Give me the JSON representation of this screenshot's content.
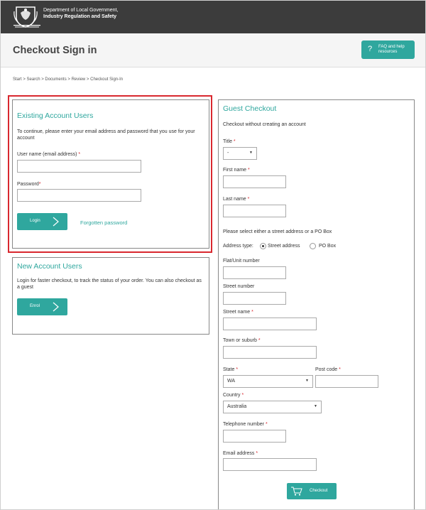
{
  "header": {
    "dept_line1": "Department of Local Government,",
    "dept_line2": "Industry Regulation and Safety",
    "page_title": "Checkout Sign in",
    "faq_label": "FAQ and help resources",
    "faq_icon": "question-icon"
  },
  "breadcrumb": [
    "Start",
    "Search",
    "Documents",
    "Review",
    "Checkout Sign-In"
  ],
  "existing": {
    "heading": "Existing Account Users",
    "intro": "To continue, please enter your email address and password that you use for your account",
    "username_label": "User name (email address)",
    "password_label": "Password",
    "login_label": "Login",
    "forgot_label": "Forgotten password"
  },
  "new_account": {
    "heading": "New Account Users",
    "intro": "Login for faster checkout, to track the status of your order. You can also checkout as a guest",
    "enrol_label": "Enrol"
  },
  "guest": {
    "heading": "Guest Checkout",
    "intro": "Checkout without creating an account",
    "title_label": "Title",
    "title_value": "-",
    "first_name_label": "First name",
    "last_name_label": "Last name",
    "address_prompt": "Please select either a street address or a PO Box",
    "address_type_label": "Address type:",
    "street_option": "Street address",
    "pobox_option": "PO Box",
    "flat_label": "Flat/Unit number",
    "street_number_label": "Street number",
    "street_name_label": "Street name",
    "town_label": "Town or suburb",
    "state_label": "State",
    "state_value": "WA",
    "postcode_label": "Post code",
    "country_label": "Country",
    "country_value": "Australia",
    "telephone_label": "Telephone number",
    "email_label": "Email address",
    "checkout_label": "Checkout"
  },
  "required_mark": "*",
  "colors": {
    "accent": "#2fa79e",
    "topbar": "#3c3c3c",
    "required": "#d9282f",
    "highlight": "#d9282f"
  }
}
